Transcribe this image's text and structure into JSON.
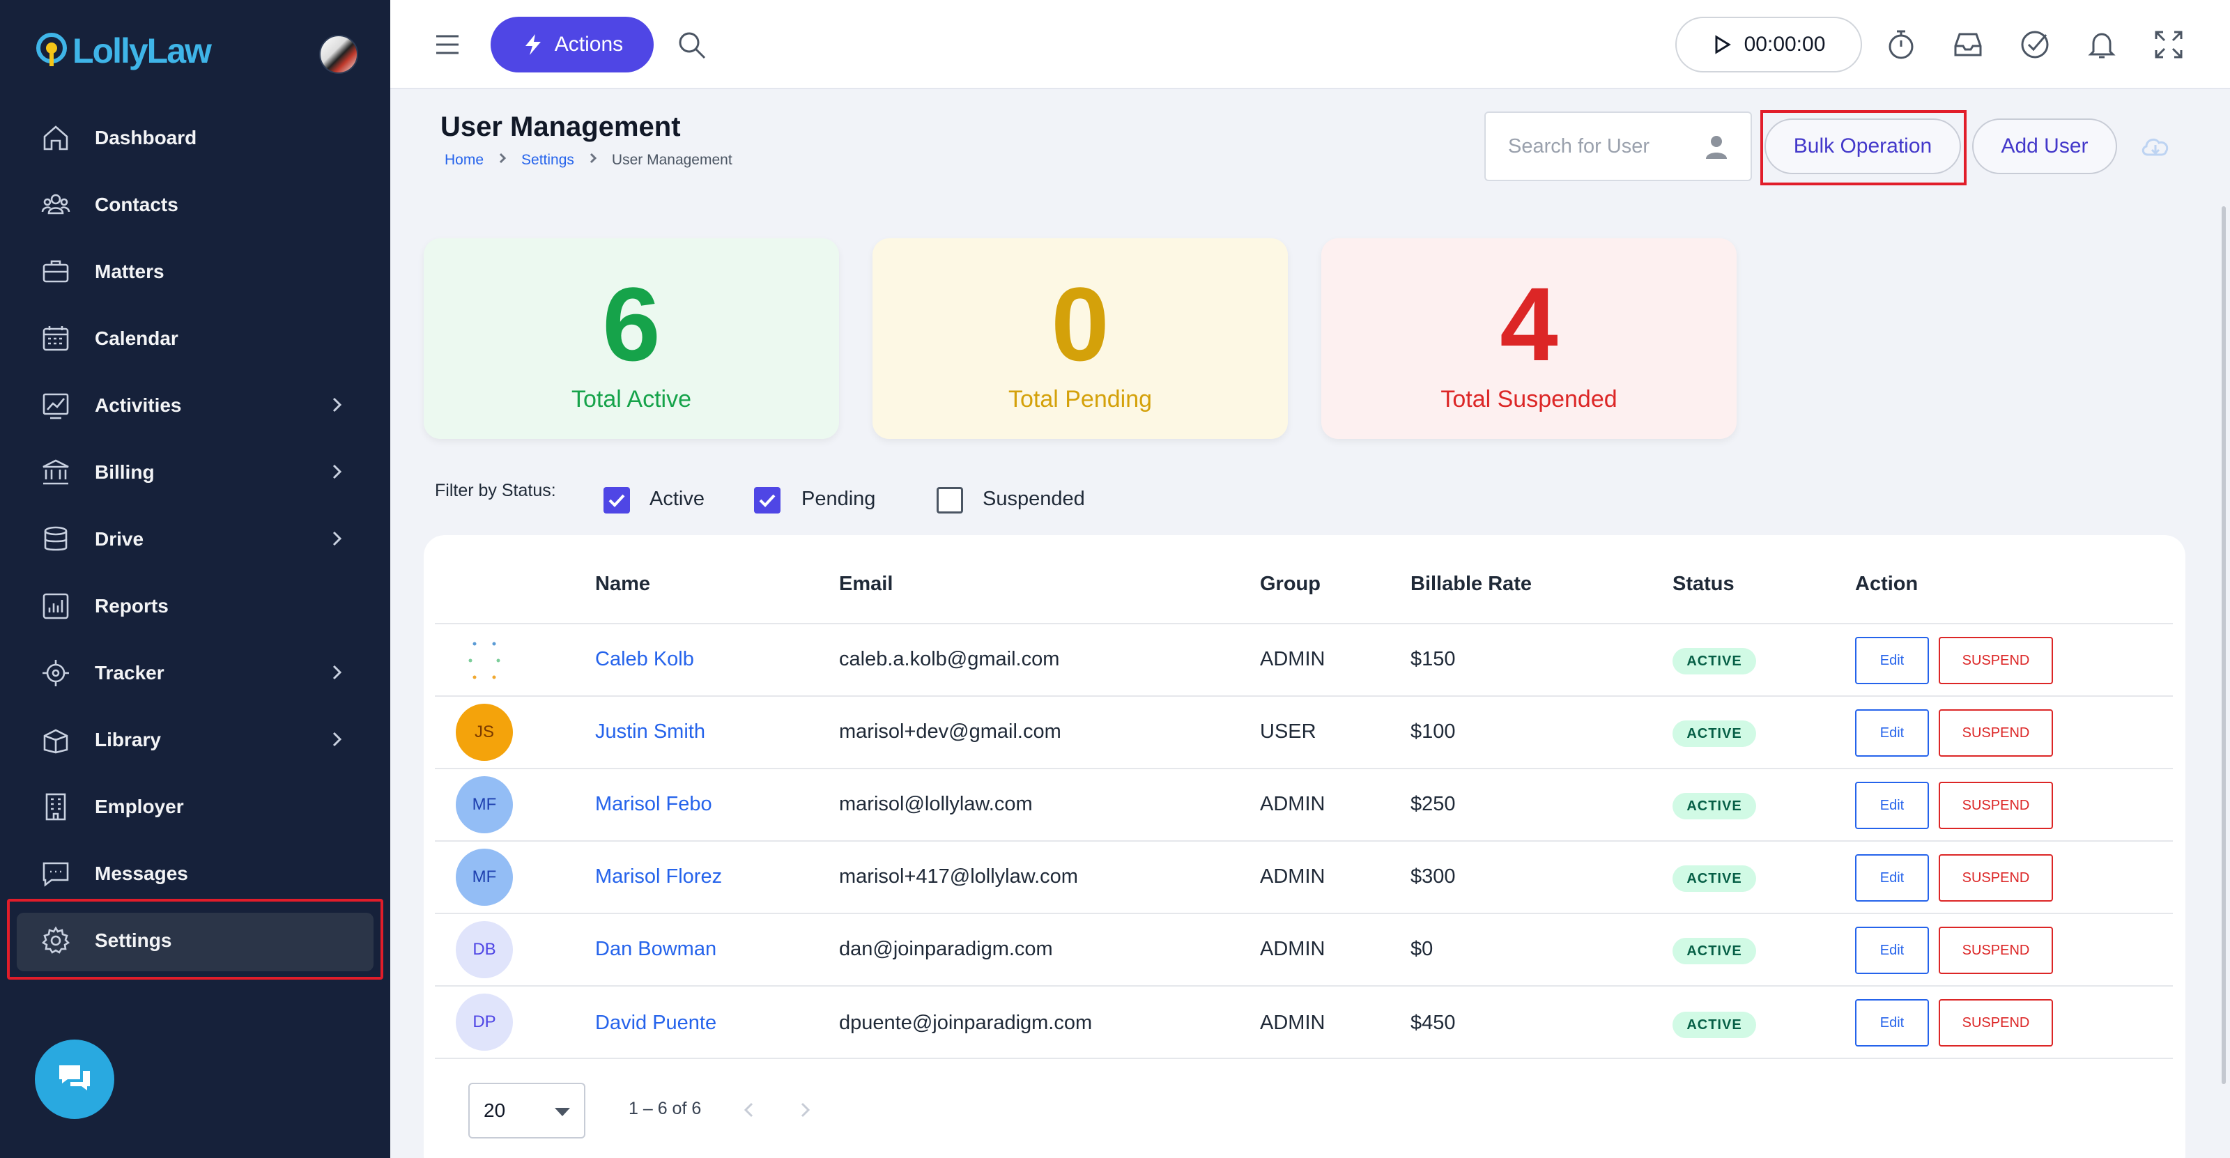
{
  "app": {
    "logo_text": "LollyLaw"
  },
  "sidebar": {
    "items": [
      {
        "label": "Dashboard",
        "icon": "home-icon",
        "chevron": false
      },
      {
        "label": "Contacts",
        "icon": "contacts-icon",
        "chevron": false
      },
      {
        "label": "Matters",
        "icon": "briefcase-icon",
        "chevron": false
      },
      {
        "label": "Calendar",
        "icon": "calendar-icon",
        "chevron": false
      },
      {
        "label": "Activities",
        "icon": "chart-icon",
        "chevron": true
      },
      {
        "label": "Billing",
        "icon": "bank-icon",
        "chevron": true
      },
      {
        "label": "Drive",
        "icon": "database-icon",
        "chevron": true
      },
      {
        "label": "Reports",
        "icon": "reports-icon",
        "chevron": false
      },
      {
        "label": "Tracker",
        "icon": "target-icon",
        "chevron": true
      },
      {
        "label": "Library",
        "icon": "library-icon",
        "chevron": true
      },
      {
        "label": "Employer",
        "icon": "building-icon",
        "chevron": false
      },
      {
        "label": "Messages",
        "icon": "message-icon",
        "chevron": false
      },
      {
        "label": "Settings",
        "icon": "gear-icon",
        "chevron": false,
        "active": true
      }
    ]
  },
  "topbar": {
    "actions_label": "Actions",
    "timer": "00:00:00"
  },
  "page": {
    "title": "User Management",
    "breadcrumb": [
      "Home",
      "Settings",
      "User Management"
    ],
    "search_placeholder": "Search for User",
    "bulk_label": "Bulk Operation",
    "add_user_label": "Add User"
  },
  "stats": [
    {
      "value": "6",
      "label": "Total Active",
      "color": "#16a34a",
      "bg": "#ecf9f0"
    },
    {
      "value": "0",
      "label": "Total Pending",
      "color": "#d4a10a",
      "bg": "#fdf8e4"
    },
    {
      "value": "4",
      "label": "Total Suspended",
      "color": "#dc2626",
      "bg": "#fdf0f0"
    }
  ],
  "filter": {
    "label": "Filter by Status:",
    "options": [
      {
        "label": "Active",
        "checked": true
      },
      {
        "label": "Pending",
        "checked": true
      },
      {
        "label": "Suspended",
        "checked": false
      }
    ]
  },
  "table": {
    "columns": [
      "Name",
      "Email",
      "Group",
      "Billable Rate",
      "Status",
      "Action"
    ],
    "rows": [
      {
        "initials": "",
        "name": "Caleb Kolb",
        "email": "caleb.a.kolb@gmail.com",
        "group": "ADMIN",
        "rate": "$150",
        "status": "ACTIVE"
      },
      {
        "initials": "JS",
        "name": "Justin Smith",
        "email": "marisol+dev@gmail.com",
        "group": "USER",
        "rate": "$100",
        "status": "ACTIVE"
      },
      {
        "initials": "MF",
        "name": "Marisol Febo",
        "email": "marisol@lollylaw.com",
        "group": "ADMIN",
        "rate": "$250",
        "status": "ACTIVE"
      },
      {
        "initials": "MF",
        "name": "Marisol Florez",
        "email": "marisol+417@lollylaw.com",
        "group": "ADMIN",
        "rate": "$300",
        "status": "ACTIVE"
      },
      {
        "initials": "DB",
        "name": "Dan Bowman",
        "email": "dan@joinparadigm.com",
        "group": "ADMIN",
        "rate": "$0",
        "status": "ACTIVE"
      },
      {
        "initials": "DP",
        "name": "David Puente",
        "email": "dpuente@joinparadigm.com",
        "group": "ADMIN",
        "rate": "$450",
        "status": "ACTIVE"
      }
    ],
    "edit_label": "Edit",
    "suspend_label": "SUSPEND"
  },
  "pager": {
    "page_size": "20",
    "range": "1 – 6 of 6"
  }
}
